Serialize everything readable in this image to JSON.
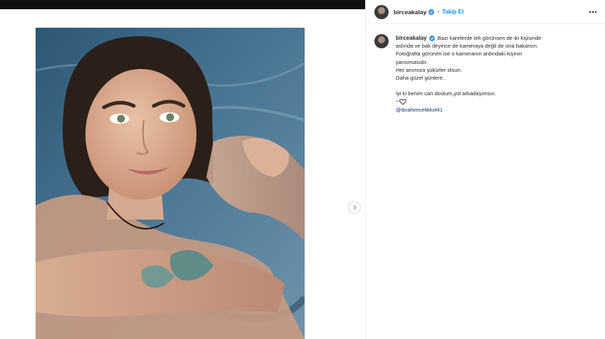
{
  "post": {
    "username": "birceakalay",
    "follow_label": "Takip Et",
    "separator": "•",
    "caption": {
      "line1": "Bazı karelerde tek görünsen de iki kişisindir",
      "line2": "aslında ve bak deyince de kameraya değil de ona bakarsın.",
      "line3": "Fotoğrafta görünen ise o kameranın ardındaki kişinin",
      "line4": "yansımasıdır.",
      "line5": "Her anımıza şükürler olsun.",
      "line6": "Daha güzel günlere..",
      "line7": "İyi ki benim can dostum,yol arkadaşımsın.",
      "line8_prefix": "~",
      "mention": "@ibrahimcelikkol41"
    }
  },
  "icons": {
    "verified": "verified-badge-icon",
    "more": "more-options-icon",
    "next": "chevron-right-icon",
    "heart": "heart-outline-icon"
  },
  "colors": {
    "accent": "#0095f6",
    "verified": "#3897f0",
    "mention": "#00376b",
    "topbar": "#111111"
  }
}
